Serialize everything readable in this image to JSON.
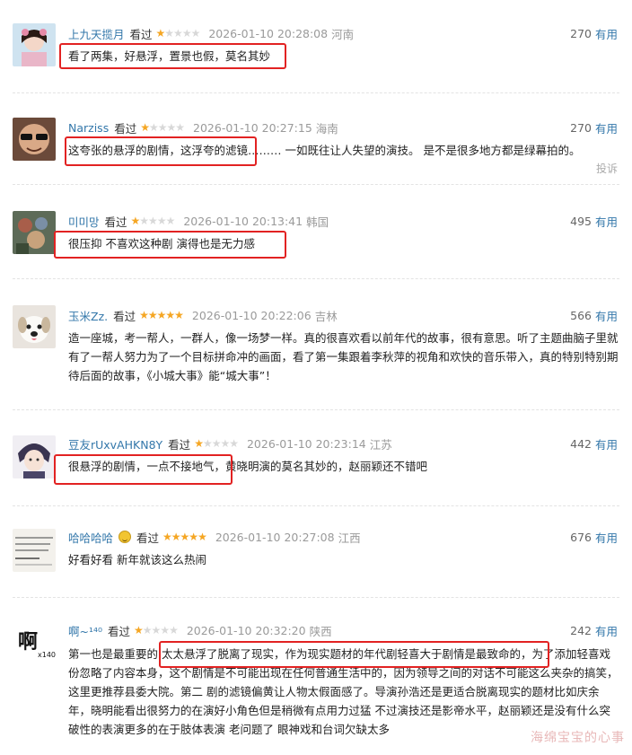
{
  "comments": [
    {
      "user": "上九天揽月",
      "seen": "看过",
      "rating": 1,
      "time": "2026-01-10 20:28:08",
      "location": "河南",
      "votes": "270",
      "useful": "有用",
      "text": "看了两集，好悬浮，置景也假，莫名其妙"
    },
    {
      "user": "Narziss",
      "seen": "看过",
      "rating": 1,
      "time": "2026-01-10 20:27:15",
      "location": "海南",
      "votes": "270",
      "useful": "有用",
      "text": "这夸张的悬浮的剧情，这浮夸的滤镜……… 一如既往让人失望的演技。 是不是很多地方都是绿幕拍的。",
      "report": "投诉"
    },
    {
      "user": "미미망",
      "seen": "看过",
      "rating": 1,
      "time": "2026-01-10 20:13:41",
      "location": "韩国",
      "votes": "495",
      "useful": "有用",
      "text": "很压抑 不喜欢这种剧 演得也是无力感"
    },
    {
      "user": "玉米Zz.",
      "seen": "看过",
      "rating": 5,
      "time": "2026-01-10 20:22:06",
      "location": "吉林",
      "votes": "566",
      "useful": "有用",
      "text": "造一座城，考一帮人，一群人，像一场梦一样。真的很喜欢看以前年代的故事，很有意思。听了主题曲脑子里就有了一帮人努力为了一个目标拼命冲的画面，看了第一集跟着李秋萍的视角和欢快的音乐带入，真的特别特别期待后面的故事，《小城大事》能“城大事”！"
    },
    {
      "user": "豆友rUxvAHKN8Y",
      "seen": "看过",
      "rating": 1,
      "time": "2026-01-10 20:23:14",
      "location": "江苏",
      "votes": "442",
      "useful": "有用",
      "text": "很悬浮的剧情，一点不接地气，黄晓明演的莫名其妙的，赵丽颖还不错吧"
    },
    {
      "user": "哈哈哈哈",
      "seen": "看过",
      "rating": 5,
      "time": "2026-01-10 20:27:08",
      "location": "江西",
      "votes": "676",
      "useful": "有用",
      "text": "好看好看 新年就该这么热闹"
    },
    {
      "user": "啊~¹⁴⁰",
      "seen": "看过",
      "rating": 1,
      "time": "2026-01-10 20:32:20",
      "location": "陕西",
      "votes": "242",
      "useful": "有用",
      "text": "第一也是最重要的 太太悬浮了脱离了现实，作为现实题材的年代剧轻喜大于剧情是最致命的，为了添加轻喜戏份忽略了内容本身，这个剧情是不可能出现在任何普通生活中的，因为领导之间的对话不可能这么夹杂的搞笑，这里更推荐县委大院。第二 剧的滤镜偏黄让人物太假面感了。导演孙浩还是更适合脱离现实的题材比如庆余年，晓明能看出很努力的在演好小角色但是稍微有点用力过猛 不过演技还是影帝水平，赵丽颖还是没有什么突破性的表演更多的在于肢体表演 老问题了 眼神戏和台词欠缺太多"
    }
  ],
  "avatar7_text": "啊",
  "avatar7_sub": "x140",
  "avatar6_text": "ually is a spiritual ... not sexual desire.",
  "watermark": "海绵宝宝的心事",
  "colors": {
    "username": "#3377aa",
    "highlight": "#e22222",
    "star": "#f5a623"
  }
}
